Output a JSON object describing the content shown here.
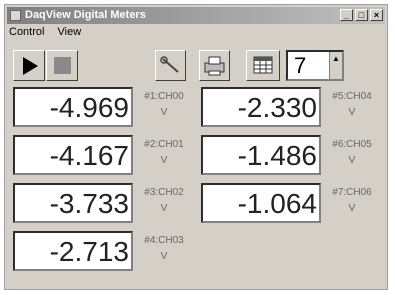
{
  "window": {
    "title": "DaqView Digital Meters",
    "min_glyph": "_",
    "max_glyph": "□",
    "close_glyph": "×"
  },
  "menu": [
    "Control",
    "View"
  ],
  "toolbar": {
    "play_icon": "play-icon",
    "stop_icon": "stop-icon",
    "probe_icon": "probe-icon",
    "print_icon": "printer-icon",
    "grid_icon": "grid-icon",
    "spin_value": "7",
    "spin_arrow": "▲"
  },
  "meters": [
    {
      "value": "-4.969",
      "label": "#1:CH00",
      "unit": "V"
    },
    {
      "value": "-4.167",
      "label": "#2:CH01",
      "unit": "V"
    },
    {
      "value": "-3.733",
      "label": "#3:CH02",
      "unit": "V"
    },
    {
      "value": "-2.713",
      "label": "#4:CH03",
      "unit": "V"
    },
    {
      "value": "-2.330",
      "label": "#5:CH04",
      "unit": "V"
    },
    {
      "value": "-1.486",
      "label": "#6:CH05",
      "unit": "V"
    },
    {
      "value": "-1.064",
      "label": "#7:CH06",
      "unit": "V"
    }
  ]
}
